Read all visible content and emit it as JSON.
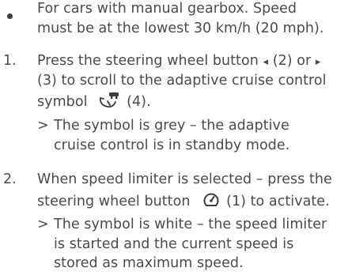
{
  "bullet": {
    "line1": "For cars with manual gearbox. Speed",
    "line2": "must be at the lowest 30 km/h (20 mph)."
  },
  "steps": [
    {
      "number": "1.",
      "line1_pre": "Press the steering wheel button",
      "left_arrow": "◂",
      "line1_mid": "(2) or",
      "right_arrow": "▸",
      "line2": "(3) to scroll to the adaptive cruise control",
      "line3_pre": "symbol",
      "line3_post": "(4).",
      "result_marker": ">",
      "result_line1": "The symbol is grey – the adaptive",
      "result_line2": "cruise control is in standby mode."
    },
    {
      "number": "2.",
      "line1": "When speed limiter is selected – press the",
      "line2_pre": "steering wheel button",
      "line2_post": "(1) to activate.",
      "result_marker": ">",
      "result_line1": "The symbol is white – the speed limiter",
      "result_line2": "is started and the current speed is",
      "result_line3": "stored as maximum speed."
    }
  ],
  "icons": {
    "acc_symbol": "adaptive-cruise-control-icon",
    "speed_limiter_button": "speedometer-icon"
  }
}
